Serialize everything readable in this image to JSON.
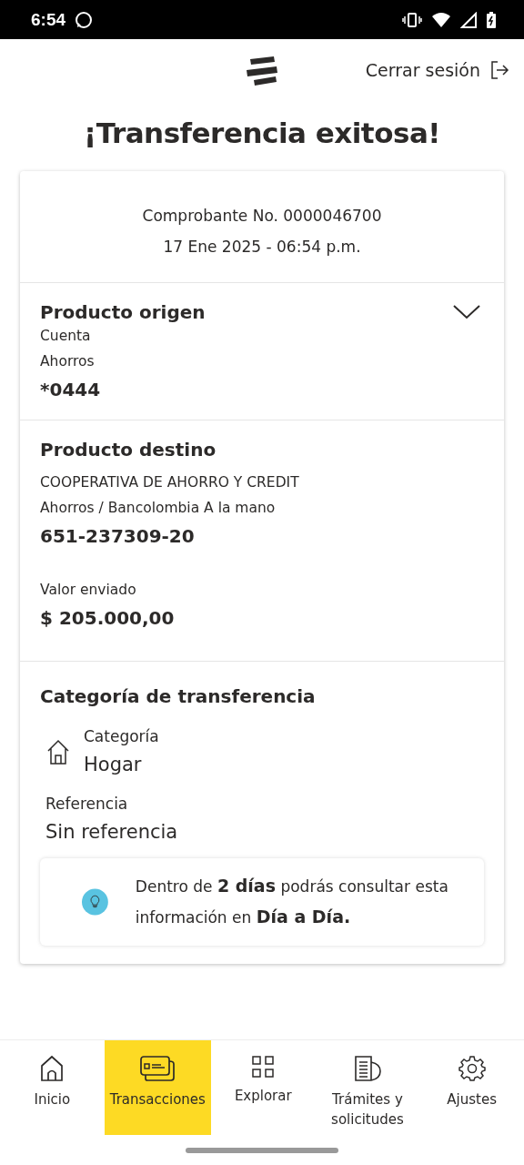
{
  "status_bar": {
    "time": "6:54"
  },
  "header": {
    "logout": "Cerrar sesión"
  },
  "title": "¡Transferencia exitosa!",
  "receipt": {
    "number": "Comprobante No. 0000046700",
    "date": "17 Ene 2025 - 06:54 p.m."
  },
  "origin": {
    "heading": "Producto origen",
    "lines": [
      "Cuenta",
      "Ahorros"
    ],
    "account": "*0444"
  },
  "destination": {
    "heading": "Producto destino",
    "lines": [
      "COOPERATIVA DE AHORRO Y CREDIT",
      "Ahorros / Bancolombia A la mano"
    ],
    "account": "651-237309-20",
    "amount_label": "Valor enviado",
    "amount": "$ 205.000,00"
  },
  "category": {
    "heading": "Categoría de transferencia",
    "label": "Categoría",
    "value": "Hogar",
    "reference_label": "Referencia",
    "reference": "Sin referencia"
  },
  "tip": "Dentro de **2 días** podrás consultar esta información en **Día a Día.**",
  "nav": [
    {
      "kind": "home",
      "label": "Inicio",
      "selected": false
    },
    {
      "kind": "cards",
      "label": "Transacciones",
      "selected": true
    },
    {
      "kind": "grid",
      "label": "Explorar",
      "selected": false
    },
    {
      "kind": "docs",
      "label": "Trámites y solicitudes",
      "selected": false
    },
    {
      "kind": "gear",
      "label": "Ajustes",
      "selected": false
    }
  ]
}
